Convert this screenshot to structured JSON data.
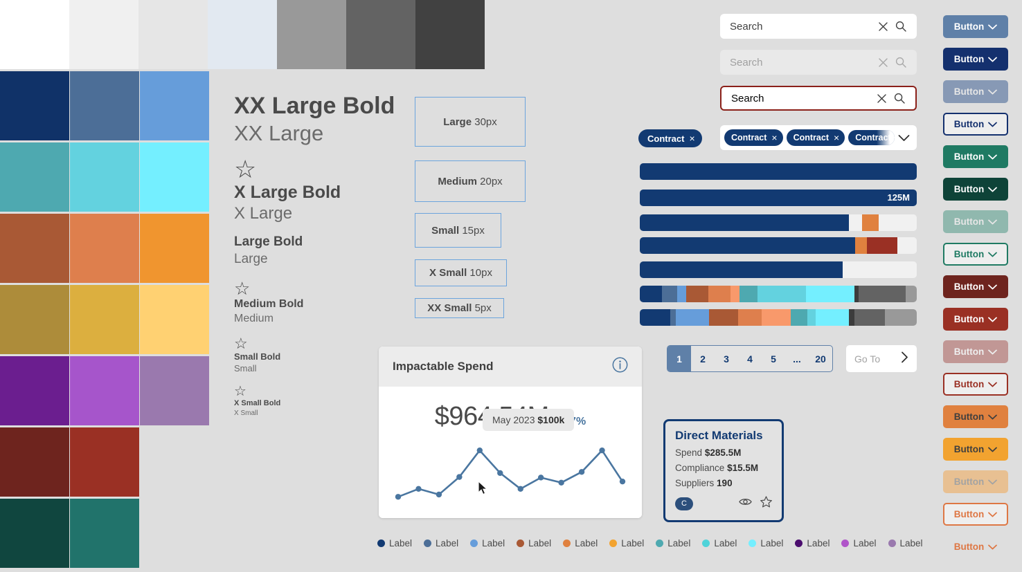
{
  "palette": {
    "neutral_row": [
      "#ffffff",
      "#f0f0f0",
      "#e6e6e6",
      "#e2e9f1",
      "#999999",
      "#636363",
      "#414141"
    ],
    "rows": [
      [
        "#103268",
        "#4c6e97",
        "#669dda"
      ],
      [
        "#4ea9b0",
        "#63d2df",
        "#74efff"
      ],
      [
        "#a95935",
        "#de7f4d",
        "#f0952f"
      ],
      [
        "#ad8c3a",
        "#dcaf3f",
        "#ffd172"
      ],
      [
        "#6b1e8f",
        "#a655cb",
        "#9a79ae"
      ],
      [
        "#6e241e",
        "#9a3024"
      ],
      [
        "#10463f",
        "#21736b"
      ]
    ]
  },
  "typography": {
    "samples": [
      {
        "label": "XX Large Bold",
        "style": "t-xxl-b"
      },
      {
        "label": "XX Large",
        "style": "t-xxl"
      },
      {
        "label": "X Large Bold",
        "style": "t-xl-b"
      },
      {
        "label": "X Large",
        "style": "t-xl"
      },
      {
        "label": "Large Bold",
        "style": "t-l-b"
      },
      {
        "label": "Large",
        "style": "t-l"
      },
      {
        "label": "Medium Bold",
        "style": "t-m-b"
      },
      {
        "label": "Medium",
        "style": "t-m"
      },
      {
        "label": "Small Bold",
        "style": "t-s-b"
      },
      {
        "label": "Small",
        "style": "t-s"
      },
      {
        "label": "X Small Bold",
        "style": "t-xs-b"
      },
      {
        "label": "X Small",
        "style": "t-xs"
      }
    ],
    "star_glyph": "☆",
    "size_boxes": [
      {
        "name": "Large",
        "size": "30px"
      },
      {
        "name": "Medium",
        "size": "20px"
      },
      {
        "name": "Small",
        "size": "15px"
      },
      {
        "name": "X Small",
        "size": "10px"
      },
      {
        "name": "XX Small",
        "size": "5px"
      }
    ]
  },
  "search_fields": [
    {
      "state": "default",
      "value": "Search",
      "placeholder": "Search"
    },
    {
      "state": "disabled",
      "value": "Search",
      "placeholder": "Search"
    },
    {
      "state": "error",
      "value": "Search",
      "placeholder": "Search"
    }
  ],
  "chips": {
    "standalone": {
      "label": "Contract",
      "remove": "×"
    },
    "in_field": [
      {
        "label": "Contract",
        "remove": "×"
      },
      {
        "label": "Contract",
        "remove": "×"
      },
      {
        "label": "Contract",
        "remove": "×"
      }
    ]
  },
  "progress_bars": [
    {
      "name": "full-primary",
      "segments": [
        {
          "color": "#123a72",
          "pct": 100
        }
      ],
      "label": ""
    },
    {
      "name": "full-primary-labeled",
      "segments": [
        {
          "color": "#123a72",
          "pct": 100
        }
      ],
      "label": "125M"
    },
    {
      "name": "split-primary-orange",
      "segments": [
        {
          "color": "#123a72",
          "pct": 75.5
        },
        {
          "color": "#f1f1f1",
          "pct": 4.8
        },
        {
          "color": "#e0813f",
          "pct": 6.0
        },
        {
          "color": "#f1f1f1",
          "pct": 13.7
        }
      ],
      "label": ""
    },
    {
      "name": "primary-orange-red",
      "segments": [
        {
          "color": "#123a72",
          "pct": 77.8
        },
        {
          "color": "#e0813f",
          "pct": 4.3
        },
        {
          "color": "#9a3024",
          "pct": 11.0
        },
        {
          "color": "#f1f1f1",
          "pct": 6.9
        }
      ],
      "label": ""
    },
    {
      "name": "primary-partial",
      "segments": [
        {
          "color": "#123a72",
          "pct": 73.3
        },
        {
          "color": "#f1f1f1",
          "pct": 26.7
        }
      ],
      "label": ""
    },
    {
      "name": "stacked-a",
      "segments": [
        {
          "color": "#123a72",
          "pct": 8.0
        },
        {
          "color": "#4c6e97",
          "pct": 5.6
        },
        {
          "color": "#669dda",
          "pct": 3.2
        },
        {
          "color": "#a95935",
          "pct": 8.0
        },
        {
          "color": "#de7f4d",
          "pct": 8.0
        },
        {
          "color": "#f8996b",
          "pct": 3.2
        },
        {
          "color": "#4ea9b0",
          "pct": 6.4
        },
        {
          "color": "#63d2df",
          "pct": 17.5
        },
        {
          "color": "#74efff",
          "pct": 17.5
        },
        {
          "color": "#3c3c3c",
          "pct": 1.6
        },
        {
          "color": "#636363",
          "pct": 17.0
        },
        {
          "color": "#999999",
          "pct": 4.0
        }
      ],
      "label": ""
    },
    {
      "name": "stacked-b",
      "segments": [
        {
          "color": "#123a72",
          "pct": 11.0
        },
        {
          "color": "#4c6e97",
          "pct": 2.0
        },
        {
          "color": "#669dda",
          "pct": 12.0
        },
        {
          "color": "#a95935",
          "pct": 10.5
        },
        {
          "color": "#de7f4d",
          "pct": 8.5
        },
        {
          "color": "#f8996b",
          "pct": 10.5
        },
        {
          "color": "#4ea9b0",
          "pct": 6.0
        },
        {
          "color": "#63d2df",
          "pct": 3.0
        },
        {
          "color": "#74efff",
          "pct": 12.0
        },
        {
          "color": "#3c3c3c",
          "pct": 2.0
        },
        {
          "color": "#636363",
          "pct": 11.0
        },
        {
          "color": "#999999",
          "pct": 11.5
        }
      ],
      "label": ""
    }
  ],
  "pagination": {
    "pages": [
      "1",
      "2",
      "3",
      "4",
      "5",
      "...",
      "20"
    ],
    "active": "1",
    "goto_label": "Go To"
  },
  "kpi_card": {
    "title": "Impactable Spend",
    "info_icon": "info-icon",
    "value": "$964.54M",
    "delta": "+17%",
    "tooltip": {
      "period": "May 2023",
      "value": "$100k"
    }
  },
  "chart_data": {
    "type": "line",
    "title": "Impactable Spend",
    "series": [
      {
        "name": "Impactable Spend",
        "points": [
          {
            "x": 0,
            "y": 18
          },
          {
            "x": 1,
            "y": 32
          },
          {
            "x": 2,
            "y": 22
          },
          {
            "x": 3,
            "y": 53
          },
          {
            "x": 4,
            "y": 100,
            "label": "May 2023 $100k"
          },
          {
            "x": 5,
            "y": 60
          },
          {
            "x": 6,
            "y": 32
          },
          {
            "x": 7,
            "y": 52
          },
          {
            "x": 8,
            "y": 43
          },
          {
            "x": 9,
            "y": 62
          },
          {
            "x": 10,
            "y": 100
          },
          {
            "x": 11,
            "y": 45
          }
        ]
      }
    ],
    "line_color": "#4a76a0",
    "grid": false,
    "legend": "none",
    "xlabel": "",
    "ylabel": ""
  },
  "tile": {
    "title": "Direct Materials",
    "rows": [
      {
        "label": "Spend",
        "value": "$285.5M"
      },
      {
        "label": "Compliance",
        "value": "$15.5M"
      },
      {
        "label": "Suppliers",
        "value": "190"
      }
    ],
    "avatar": "C",
    "icons": [
      "eye-icon",
      "star-icon"
    ]
  },
  "legend": [
    {
      "label": "Label",
      "color": "#123a72"
    },
    {
      "label": "Label",
      "color": "#4c6e97"
    },
    {
      "label": "Label",
      "color": "#669dda"
    },
    {
      "label": "Label",
      "color": "#a95935"
    },
    {
      "label": "Label",
      "color": "#e0813f"
    },
    {
      "label": "Label",
      "color": "#f2a330"
    },
    {
      "label": "Label",
      "color": "#4ea9b0"
    },
    {
      "label": "Label",
      "color": "#4fd3d9"
    },
    {
      "label": "Label",
      "color": "#74efff"
    },
    {
      "label": "Label",
      "color": "#4b0d6e"
    },
    {
      "label": "Label",
      "color": "#b055c9"
    },
    {
      "label": "Label",
      "color": "#9a79ae"
    }
  ],
  "buttons": [
    {
      "label": "Button",
      "variant": "primary-hover",
      "bg": "#5f80a8",
      "fg": "#ffffff",
      "border": "none"
    },
    {
      "label": "Button",
      "variant": "primary",
      "bg": "#14306e",
      "fg": "#ffffff",
      "border": "none"
    },
    {
      "label": "Button",
      "variant": "primary-disabled",
      "bg": "#8799b5",
      "fg": "#e6e6e6",
      "border": "none"
    },
    {
      "label": "Button",
      "variant": "primary-outline",
      "bg": "#eeeeee",
      "fg": "#14306e",
      "border": "#14306e"
    },
    {
      "label": "Button",
      "variant": "success-hover",
      "bg": "#1f7a63",
      "fg": "#ffffff",
      "border": "none"
    },
    {
      "label": "Button",
      "variant": "success",
      "bg": "#0e4338",
      "fg": "#ffffff",
      "border": "none"
    },
    {
      "label": "Button",
      "variant": "success-disabled",
      "bg": "#90b8ae",
      "fg": "#e6e6e6",
      "border": "none"
    },
    {
      "label": "Button",
      "variant": "success-outline",
      "bg": "#eeeeee",
      "fg": "#1f7a63",
      "border": "#1f7a63"
    },
    {
      "label": "Button",
      "variant": "danger-hover",
      "bg": "#6e241e",
      "fg": "#ffffff",
      "border": "none"
    },
    {
      "label": "Button",
      "variant": "danger",
      "bg": "#9a3024",
      "fg": "#ffffff",
      "border": "none"
    },
    {
      "label": "Button",
      "variant": "danger-disabled",
      "bg": "#c19795",
      "fg": "#eeeeee",
      "border": "none"
    },
    {
      "label": "Button",
      "variant": "danger-outline",
      "bg": "#eeeeee",
      "fg": "#9a3024",
      "border": "#9a3024"
    },
    {
      "label": "Button",
      "variant": "warning-hover",
      "bg": "#e0813f",
      "fg": "#3f3f3f",
      "border": "none"
    },
    {
      "label": "Button",
      "variant": "warning",
      "bg": "#f2a330",
      "fg": "#3f3f3f",
      "border": "none"
    },
    {
      "label": "Button",
      "variant": "warning-disabled",
      "bg": "#e8c092",
      "fg": "#a3a3a3",
      "border": "none"
    },
    {
      "label": "Button",
      "variant": "warning-outline",
      "bg": "#eeeeee",
      "fg": "#de7744",
      "border": "#de7744"
    },
    {
      "label": "Button",
      "variant": "warning-text",
      "bg": "transparent",
      "fg": "#de7744",
      "border": "none"
    }
  ]
}
